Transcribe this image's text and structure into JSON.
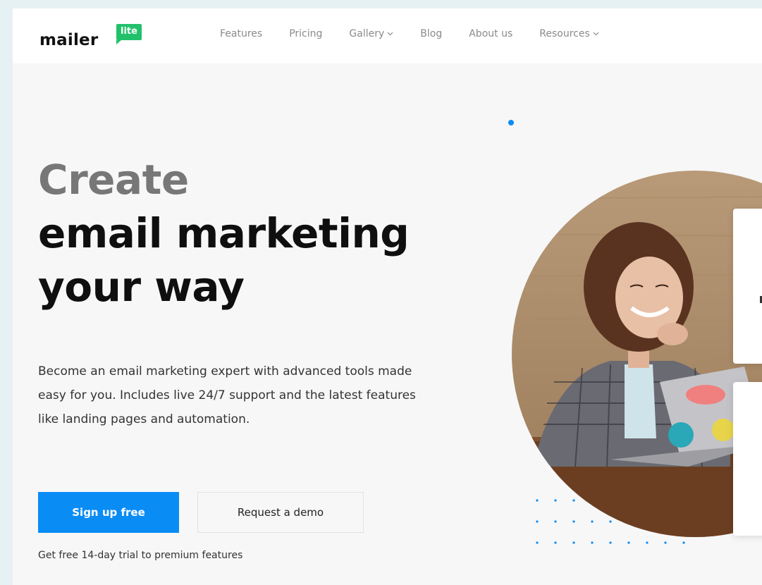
{
  "brand": {
    "name": "mailer",
    "badge": "lite",
    "badge_color": "#21c16b"
  },
  "nav": {
    "items": [
      {
        "label": "Features",
        "has_dropdown": false
      },
      {
        "label": "Pricing",
        "has_dropdown": false
      },
      {
        "label": "Gallery",
        "has_dropdown": true
      },
      {
        "label": "Blog",
        "has_dropdown": false
      },
      {
        "label": "About us",
        "has_dropdown": false
      },
      {
        "label": "Resources",
        "has_dropdown": true
      }
    ]
  },
  "hero": {
    "headline_line1": "Create",
    "headline_line2": "email marketing",
    "headline_line3": "your way",
    "description": "Become an email marketing expert with advanced tools made easy for you. Includes live 24/7 support and the latest features like landing pages and automation.",
    "primary_cta": "Sign up free",
    "secondary_cta": "Request a demo",
    "trial_note": "Get free 14-day trial to premium features"
  },
  "colors": {
    "accent": "#0a8cf5",
    "brand_green": "#21c16b",
    "headline_grey": "#777777",
    "headline_dark": "#0f0f0f"
  },
  "icons": {
    "nav_dropdown": "chevron-down-icon"
  }
}
